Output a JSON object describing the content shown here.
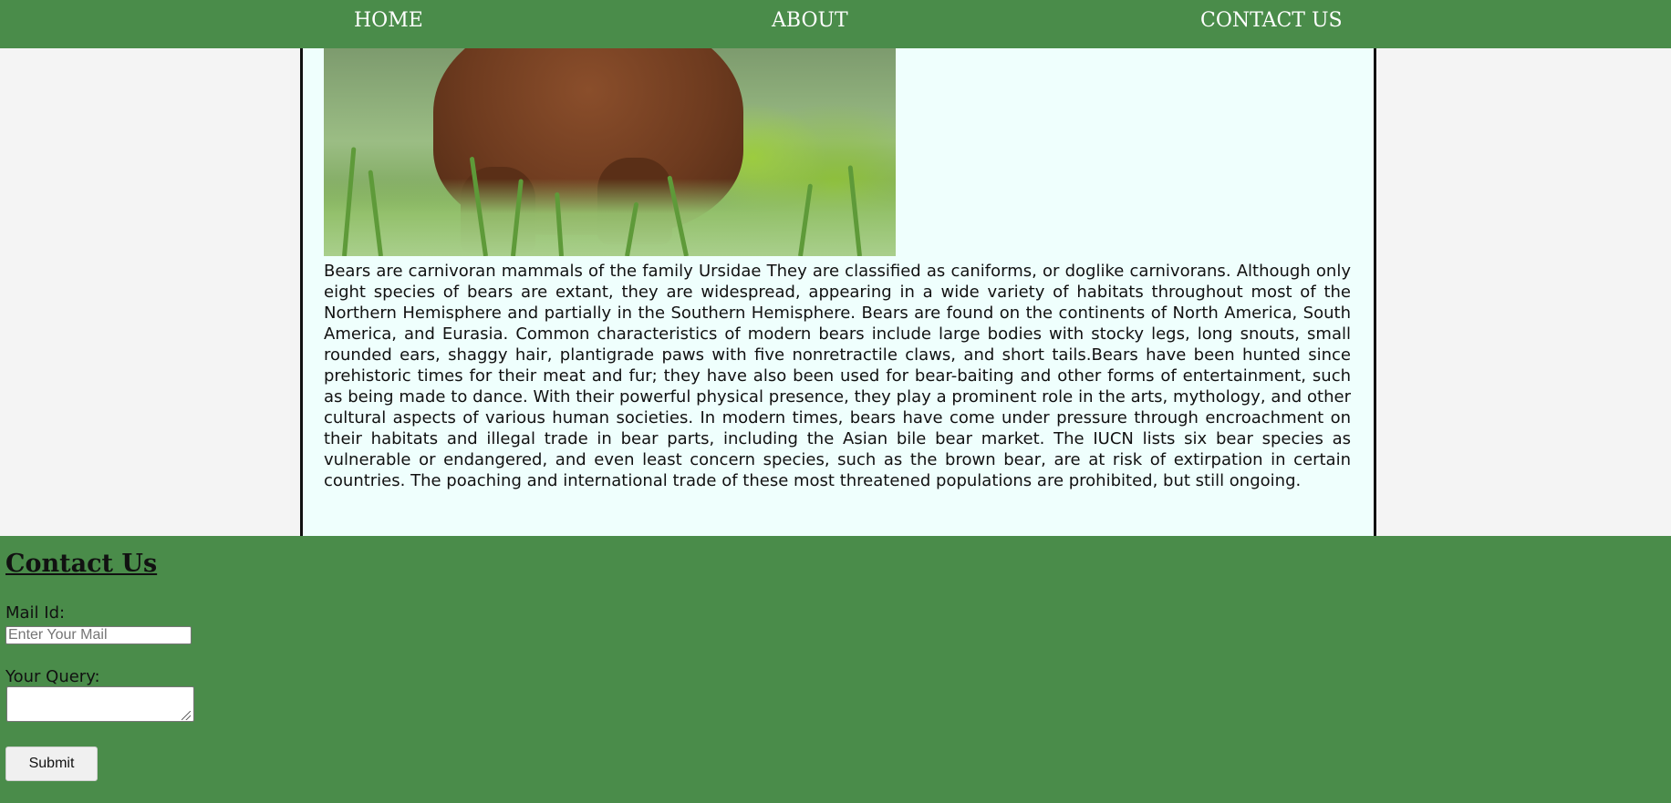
{
  "nav": {
    "home": "HOME",
    "about": "ABOUT",
    "contact": "CONTACT US"
  },
  "article": {
    "image_subject": "brown bear standing in green grass",
    "body": "Bears are carnivoran mammals of the family Ursidae They are classified as caniforms, or doglike carnivorans. Although only eight species of bears are extant, they are widespread, appearing in a wide variety of habitats throughout most of the Northern Hemisphere and partially in the Southern Hemisphere. Bears are found on the continents of North America, South America, and Eurasia. Common characteristics of modern bears include large bodies with stocky legs, long snouts, small rounded ears, shaggy hair, plantigrade paws with five nonretractile claws, and short tails.Bears have been hunted since prehistoric times for their meat and fur; they have also been used for bear-baiting and other forms of entertainment, such as being made to dance. With their powerful physical presence, they play a prominent role in the arts, mythology, and other cultural aspects of various human societies. In modern times, bears have come under pressure through encroachment on their habitats and illegal trade in bear parts, including the Asian bile bear market. The IUCN lists six bear species as vulnerable or endangered, and even least concern species, such as the brown bear, are at risk of extirpation in certain countries. The poaching and international trade of these most threatened populations are prohibited, but still ongoing."
  },
  "contact": {
    "title": "Contact Us",
    "mail_label": "Mail Id:",
    "mail_placeholder": "Enter Your Mail",
    "mail_value": "",
    "query_label": "Your Query:",
    "query_value": "",
    "submit_label": "Submit"
  },
  "colors": {
    "green_bar": "#4a8c4a",
    "article_bg": "#effffd",
    "page_bg": "#f4f4f4"
  }
}
